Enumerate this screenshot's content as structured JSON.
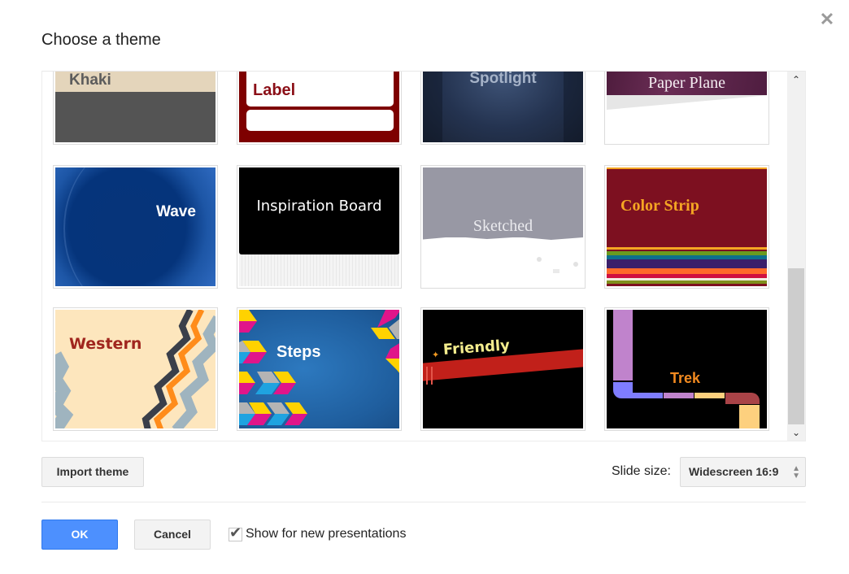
{
  "dialog": {
    "title": "Choose a theme",
    "close_icon": "close-icon"
  },
  "themes": [
    {
      "name": "Khaki"
    },
    {
      "name": "Label"
    },
    {
      "name": "Spotlight"
    },
    {
      "name": "Paper Plane"
    },
    {
      "name": "Wave"
    },
    {
      "name": "Inspiration Board"
    },
    {
      "name": "Sketched"
    },
    {
      "name": "Color Strip"
    },
    {
      "name": "Western"
    },
    {
      "name": "Steps"
    },
    {
      "name": "Friendly"
    },
    {
      "name": "Trek"
    }
  ],
  "footer": {
    "import_label": "Import theme",
    "slide_size_label": "Slide size:",
    "slide_size_value": "Widescreen 16:9",
    "ok_label": "OK",
    "cancel_label": "Cancel",
    "show_checkbox_label": "Show for new presentations",
    "show_checkbox_checked": true
  },
  "colors": {
    "primary_button": "#4d90fe"
  }
}
